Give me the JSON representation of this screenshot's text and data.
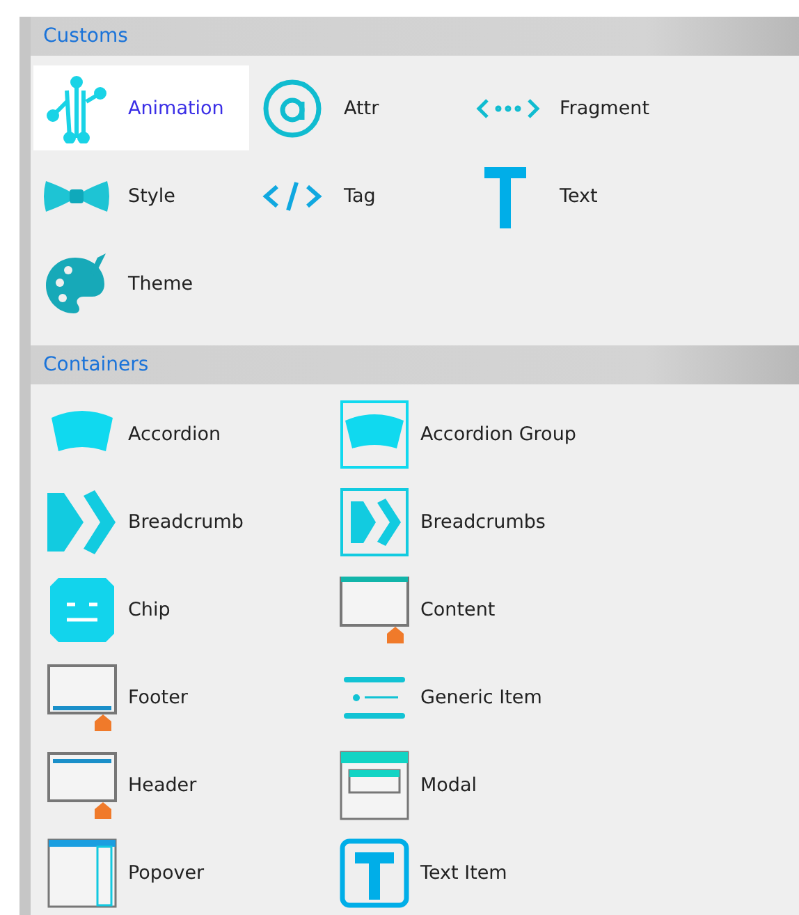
{
  "sections": [
    {
      "title": "Customs",
      "items": [
        {
          "label": "Animation",
          "kind": "animation",
          "selected": true
        },
        {
          "label": "Attr",
          "kind": "attr",
          "selected": false
        },
        {
          "label": "Fragment",
          "kind": "fragment",
          "selected": false
        },
        {
          "label": "Style",
          "kind": "style",
          "selected": false
        },
        {
          "label": "Tag",
          "kind": "tag",
          "selected": false
        },
        {
          "label": "Text",
          "kind": "text",
          "selected": false
        },
        {
          "label": "Theme",
          "kind": "theme",
          "selected": false
        }
      ]
    },
    {
      "title": "Containers",
      "items": [
        {
          "label": "Accordion",
          "kind": "accordion",
          "selected": false
        },
        {
          "label": "Accordion Group",
          "kind": "accordion-group",
          "selected": false
        },
        {
          "label": "Breadcrumb",
          "kind": "breadcrumb",
          "selected": false
        },
        {
          "label": "Breadcrumbs",
          "kind": "breadcrumbs",
          "selected": false
        },
        {
          "label": "Chip",
          "kind": "chip",
          "selected": false
        },
        {
          "label": "Content",
          "kind": "content",
          "selected": false
        },
        {
          "label": "Footer",
          "kind": "footer",
          "selected": false
        },
        {
          "label": "Generic Item",
          "kind": "generic-item",
          "selected": false
        },
        {
          "label": "Header",
          "kind": "header",
          "selected": false
        },
        {
          "label": "Modal",
          "kind": "modal",
          "selected": false
        },
        {
          "label": "Popover",
          "kind": "popover",
          "selected": false
        },
        {
          "label": "Text Item",
          "kind": "text-item",
          "selected": false
        }
      ]
    }
  ]
}
